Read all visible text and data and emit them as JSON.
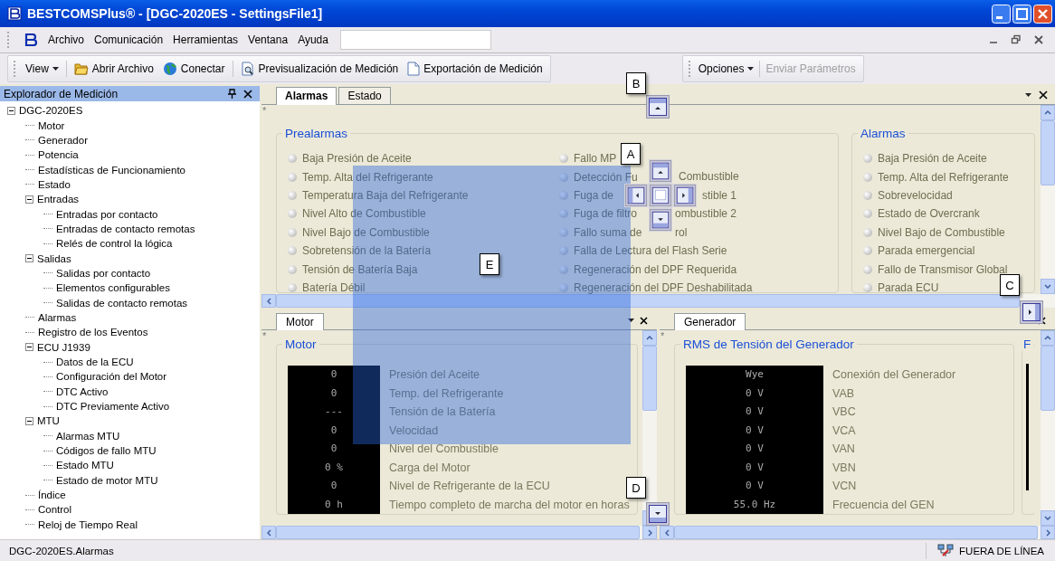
{
  "window": {
    "title": "BESTCOMSPlus® - [DGC-2020ES - SettingsFile1]"
  },
  "menu": [
    "Archivo",
    "Comunicación",
    "Herramientas",
    "Ventana",
    "Ayuda"
  ],
  "toolbar": [
    {
      "kind": "dropdown",
      "label": "View"
    },
    {
      "kind": "open",
      "label": "Abrir Archivo"
    },
    {
      "kind": "connect",
      "label": "Conectar"
    },
    {
      "kind": "preview",
      "label": "Previsualización de Medición"
    },
    {
      "kind": "export",
      "label": "Exportación de Medición"
    }
  ],
  "toolbar2": [
    {
      "label": "Opciones",
      "disabled": false,
      "dropdown": true
    },
    {
      "label": "Enviar Parámetros",
      "disabled": true,
      "dropdown": false
    }
  ],
  "explorer": {
    "title": "Explorador de Medición",
    "tree": [
      {
        "label": "DGC-2020ES",
        "expanded": true,
        "children": [
          {
            "label": "Motor"
          },
          {
            "label": "Generador"
          },
          {
            "label": "Potencia"
          },
          {
            "label": "Estadísticas de Funcionamiento"
          },
          {
            "label": "Estado"
          },
          {
            "label": "Entradas",
            "expanded": true,
            "children": [
              {
                "label": "Entradas por contacto"
              },
              {
                "label": "Entradas de contacto remotas"
              },
              {
                "label": "Relés de control la lógica"
              }
            ]
          },
          {
            "label": "Salidas",
            "expanded": true,
            "children": [
              {
                "label": "Salidas por contacto"
              },
              {
                "label": "Elementos configurables"
              },
              {
                "label": "Salidas de contacto remotas"
              }
            ]
          },
          {
            "label": "Alarmas"
          },
          {
            "label": "Registro de los Eventos"
          },
          {
            "label": "ECU J1939",
            "expanded": true,
            "children": [
              {
                "label": "Datos de la ECU"
              },
              {
                "label": "Configuración del Motor"
              },
              {
                "label": "DTC Activo"
              },
              {
                "label": "DTC Previamente Activo"
              }
            ]
          },
          {
            "label": "MTU",
            "expanded": true,
            "children": [
              {
                "label": "Alarmas MTU"
              },
              {
                "label": "Códigos de fallo MTU"
              },
              {
                "label": "Estado MTU"
              },
              {
                "label": "Estado de motor MTU"
              }
            ]
          },
          {
            "label": "Índice"
          },
          {
            "label": "Control"
          },
          {
            "label": "Reloj de Tiempo Real"
          }
        ]
      }
    ]
  },
  "main_marker": "*",
  "main_tabs": [
    {
      "label": "Alarmas",
      "selected": true
    },
    {
      "label": "Estado",
      "selected": false
    }
  ],
  "prealarmas": {
    "title": "Prealarmas",
    "columns": [
      [
        {
          "text": "Baja Presión de Aceite"
        },
        {
          "text": "Temp. Alta del Refrigerante"
        },
        {
          "text": "Temperatura Baja del Refrigerante"
        },
        {
          "text": "Nivel Alto de Combustible"
        },
        {
          "text": "Nivel Bajo de Combustible"
        },
        {
          "text": "Sobretensión de la Batería"
        },
        {
          "text": "Tensión de Batería Baja"
        },
        {
          "text": "Batería Débil"
        }
      ],
      [
        {
          "text": "Fallo MP"
        },
        {
          "text": "Detección Fu",
          "tail": "Combustible"
        },
        {
          "text": "Fuga de",
          "tail": "stible 1"
        },
        {
          "text": "Fuga de filtro",
          "tail": "ombustible 2"
        },
        {
          "text": "Fallo suma de",
          "tail": "rol"
        },
        {
          "text": "Falla de Lectura del Flash Serie"
        },
        {
          "text": "Regeneración del DPF Requerida"
        },
        {
          "text": "Regeneración del DPF Deshabilitada"
        }
      ]
    ]
  },
  "alarmas": {
    "title": "Alarmas",
    "items": [
      "Baja Presión de Aceite",
      "Temp. Alta del Refrigerante",
      "Sobrevelocidad",
      "Estado de Overcrank",
      "Nivel Bajo de Combustible",
      "Parada emergencial",
      "Fallo de Transmisor Global",
      "Parada ECU"
    ]
  },
  "motor_pane": {
    "tab": "Motor",
    "marker": "*",
    "group": "Motor",
    "rows": [
      {
        "value": "0",
        "label": "Presión del Aceite"
      },
      {
        "value": "0",
        "label": "Temp. del Refrigerante"
      },
      {
        "value": "---",
        "label": "Tensión de la Batería"
      },
      {
        "value": "0",
        "label": "Velocidad"
      },
      {
        "value": "0",
        "label": "Nivel del Combustible"
      },
      {
        "value": "0 %",
        "label": "Carga del Motor"
      },
      {
        "value": "0",
        "label": "Nivel de Refrigerante de la ECU"
      },
      {
        "value": "0 h",
        "label": "Tiempo completo de marcha del motor en horas"
      }
    ]
  },
  "generator_pane": {
    "tab": "Generador",
    "marker": "*",
    "group": "RMS de Tensión del Generador",
    "next_group": "F",
    "rows": [
      {
        "value": "Wye",
        "label": "Conexión del Generador"
      },
      {
        "value": "0 V",
        "label": "VAB"
      },
      {
        "value": "0 V",
        "label": "VBC"
      },
      {
        "value": "0 V",
        "label": "VCA"
      },
      {
        "value": "0 V",
        "label": "VAN"
      },
      {
        "value": "0 V",
        "label": "VBN"
      },
      {
        "value": "0 V",
        "label": "VCN"
      },
      {
        "value": "55.0 Hz",
        "label": "Frecuencia del GEN"
      }
    ]
  },
  "dock_labels": [
    "B",
    "A",
    "C",
    "D",
    "E"
  ],
  "status_bar": {
    "path": "DGC-2020ES.Alarmas",
    "connection": "FUERA DE LÍNEA"
  }
}
